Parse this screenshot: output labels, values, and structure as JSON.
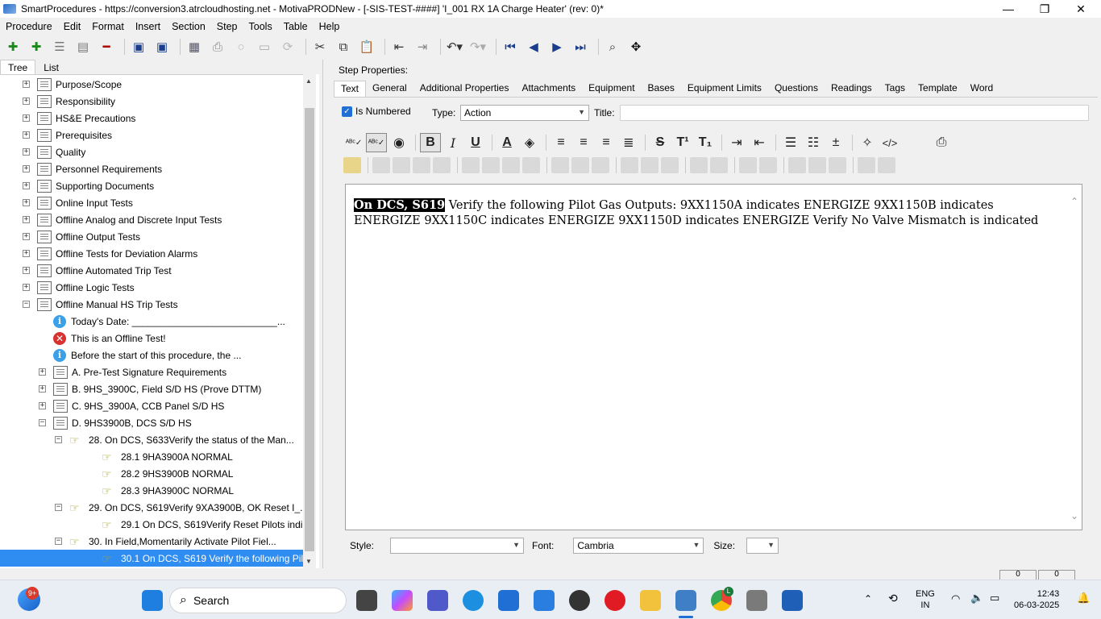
{
  "window": {
    "title": "SmartProcedures - https://conversion3.atrcloudhosting.net - MotivaPRODNew - [-SIS-TEST-####] 'I_001 RX 1A Charge Heater' (rev: 0)*",
    "minimize": "—",
    "maximize": "❐",
    "close": "✕"
  },
  "menu": [
    "Procedure",
    "Edit",
    "Format",
    "Insert",
    "Section",
    "Step",
    "Tools",
    "Table",
    "Help"
  ],
  "left_tabs": {
    "tree": "Tree",
    "list": "List"
  },
  "tree": [
    {
      "label": "Purpose/Scope",
      "icon": "document-icon",
      "exp": "+",
      "level": 0
    },
    {
      "label": "Responsibility",
      "icon": "document-icon",
      "exp": "+",
      "level": 0
    },
    {
      "label": "HS&E Precautions",
      "icon": "document-icon",
      "exp": "+",
      "level": 0
    },
    {
      "label": "Prerequisites",
      "icon": "document-icon",
      "exp": "+",
      "level": 0
    },
    {
      "label": "Quality",
      "icon": "document-icon",
      "exp": "+",
      "level": 0
    },
    {
      "label": "Personnel Requirements",
      "icon": "document-icon",
      "exp": "+",
      "level": 0
    },
    {
      "label": "Supporting Documents",
      "icon": "document-icon",
      "exp": "+",
      "level": 0
    },
    {
      "label": "Online Input Tests",
      "icon": "document-icon",
      "exp": "+",
      "level": 0
    },
    {
      "label": "Offline Analog and Discrete Input Tests",
      "icon": "document-icon",
      "exp": "+",
      "level": 0
    },
    {
      "label": "Offline Output Tests",
      "icon": "document-icon",
      "exp": "+",
      "level": 0
    },
    {
      "label": "Offline Tests for Deviation Alarms",
      "icon": "document-icon",
      "exp": "+",
      "level": 0
    },
    {
      "label": "Offline Automated Trip Test",
      "icon": "document-icon",
      "exp": "+",
      "level": 0
    },
    {
      "label": "Offline Logic Tests",
      "icon": "document-icon",
      "exp": "+",
      "level": 0
    },
    {
      "label": "Offline Manual HS Trip Tests",
      "icon": "document-icon",
      "exp": "−",
      "level": 0
    },
    {
      "label": "Today's Date: ___________________________...",
      "icon": "info-icon",
      "exp": "",
      "level": 1
    },
    {
      "label": "This is an Offline Test!",
      "icon": "error-icon",
      "exp": "",
      "level": 1
    },
    {
      "label": "Before the start of this procedure, the ...",
      "icon": "info-icon",
      "exp": "",
      "level": 1
    },
    {
      "label": "A. Pre-Test Signature Requirements",
      "icon": "document-icon",
      "exp": "+",
      "level": 1
    },
    {
      "label": "B. 9HS_3900C, Field S/D HS (Prove DTTM)",
      "icon": "document-icon",
      "exp": "+",
      "level": 1
    },
    {
      "label": "C. 9HS_3900A, CCB Panel S/D HS",
      "icon": "document-icon",
      "exp": "+",
      "level": 1
    },
    {
      "label": "D. 9HS3900B, DCS S/D HS",
      "icon": "document-icon",
      "exp": "−",
      "level": 1
    },
    {
      "label": "28. On DCS, S633Verify the status of the Man...",
      "icon": "hand-icon",
      "exp": "−",
      "level": 2
    },
    {
      "label": "28.1 9HA3900A NORMAL",
      "icon": "hand-icon",
      "exp": "",
      "level": 3
    },
    {
      "label": "28.2 9HS3900B NORMAL",
      "icon": "hand-icon",
      "exp": "",
      "level": 3
    },
    {
      "label": "28.3 9HA3900C NORMAL",
      "icon": "hand-icon",
      "exp": "",
      "level": 3
    },
    {
      "label": "29. On DCS, S619Verify 9XA3900B, OK Reset I_...",
      "icon": "hand-icon",
      "exp": "−",
      "level": 2
    },
    {
      "label": "29.1 On DCS, S619Verify Reset Pilots indicate...",
      "icon": "hand-icon",
      "exp": "",
      "level": 3
    },
    {
      "label": "30. In Field,Momentarily Activate Pilot Fiel...",
      "icon": "hand-icon",
      "exp": "−",
      "level": 2
    },
    {
      "label": "30.1 On DCS, S619 Verify the following Pilot ...",
      "icon": "hand-icon",
      "exp": "",
      "level": 3,
      "selected": true
    }
  ],
  "step_properties_label": "Step Properties:",
  "right_tabs": [
    "Text",
    "General",
    "Additional Properties",
    "Attachments",
    "Equipment",
    "Bases",
    "Equipment Limits",
    "Questions",
    "Readings",
    "Tags",
    "Template",
    "Word"
  ],
  "is_numbered_label": "Is Numbered",
  "type_label": "Type:",
  "type_value": "Action",
  "title_label": "Title:",
  "title_value": "",
  "editor": {
    "highlighted": "On DCS, S619",
    "text": " Verify the following Pilot Gas Outputs: 9XX1150A indicates ENERGIZE 9XX1150B indicates ENERGIZE 9XX1150C indicates ENERGIZE 9XX1150D indicates ENERGIZE Verify No Valve Mismatch is indicated"
  },
  "style_label": "Style:",
  "style_value": "",
  "font_label": "Font:",
  "font_value": "Cambria",
  "size_label": "Size:",
  "size_value": "",
  "statusbar": {
    "cell1": "0",
    "cell2": "0"
  },
  "taskbar": {
    "search_placeholder": "Search",
    "notif_badge": "9+",
    "lang": "ENG",
    "region": "IN",
    "time": "12:43",
    "date": "06-03-2025",
    "chrome_badge": "L"
  }
}
